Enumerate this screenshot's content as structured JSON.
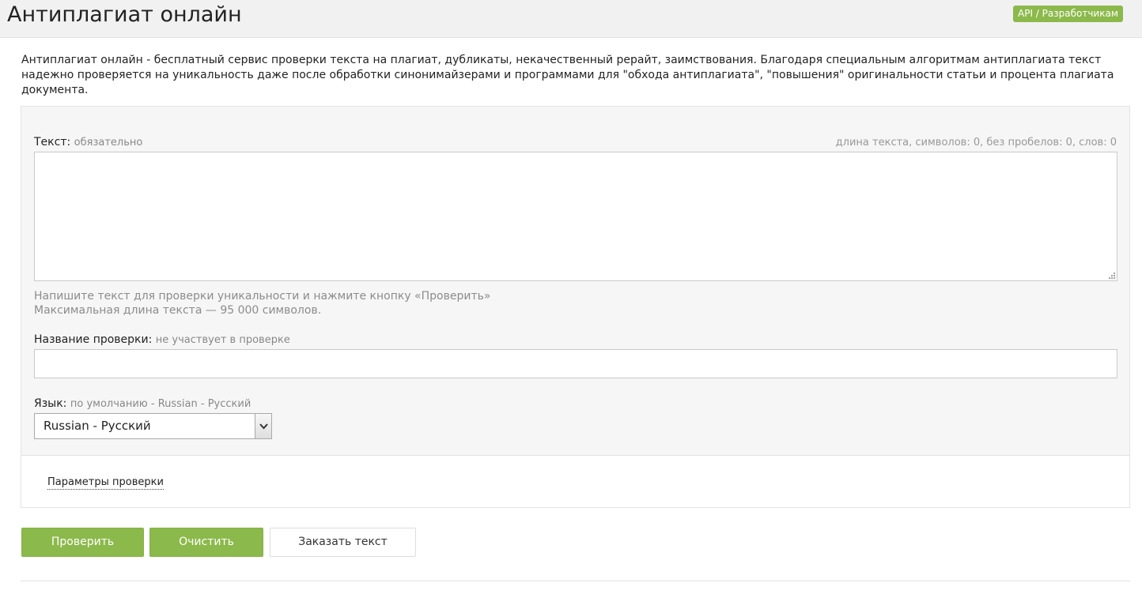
{
  "header": {
    "title": "Антиплагиат онлайн",
    "api_link": "API / Разработчикам"
  },
  "description": "Антиплагиат онлайн - бесплатный сервис проверки текста на плагиат, дубликаты, некачественный рерайт, заимствования. Благодаря специальным алгоритмам антиплагиата текст надежно проверяется на уникальность даже после обработки синонимайзерами и программами для \"обхода антиплагиата\", \"повышения\" оригинальности статьи и процента плагиата документа.",
  "form": {
    "text_field": {
      "label": "Текст:",
      "hint": "обязательно",
      "counter": "длина текста, символов: 0, без пробелов: 0, слов: 0",
      "value": "",
      "help_line1": "Напишите текст для проверки уникальности и нажмите кнопку «Проверить»",
      "help_line2": "Максимальная длина текста — 95 000 символов."
    },
    "name_field": {
      "label": "Название проверки:",
      "hint": "не участвует в проверке",
      "value": ""
    },
    "language_field": {
      "label": "Язык:",
      "hint": "по умолчанию - Russian - Русский",
      "selected": "Russian - Русский"
    },
    "params_link": "Параметры проверки"
  },
  "buttons": {
    "check": "Проверить",
    "clear": "Очистить",
    "order": "Заказать текст"
  },
  "colors": {
    "accent": "#8cb94b",
    "panel_bg": "#f6f6f6",
    "hint_text": "#888888"
  }
}
